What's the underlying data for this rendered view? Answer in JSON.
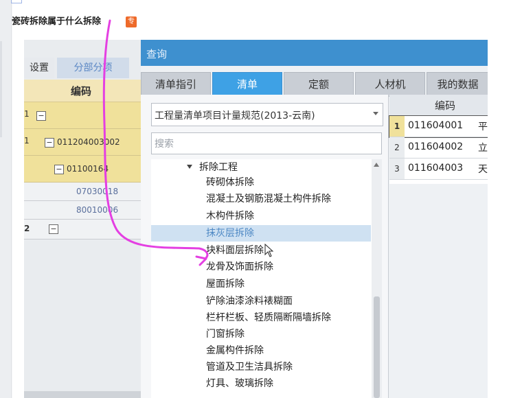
{
  "post": {
    "title": "瓷砖拆除属于什么拆除",
    "tag": "专"
  },
  "background_app": {
    "tabs": [
      "设置",
      "分部分项"
    ],
    "column_header": "编码",
    "rows": [
      {
        "num": "1",
        "code": "",
        "style": "yellow"
      },
      {
        "num": "1",
        "code": "011204003002",
        "style": "yellow"
      },
      {
        "num": "",
        "code": "01100164",
        "style": "yellow"
      },
      {
        "num": "",
        "code": "07030018",
        "style": "white"
      },
      {
        "num": "",
        "code": "80010006",
        "style": "white"
      },
      {
        "num": "2",
        "code": "",
        "style": "white"
      }
    ]
  },
  "dialog": {
    "title": "查询",
    "tabs": [
      "清单指引",
      "清单",
      "定额",
      "人材机",
      "我的数据"
    ],
    "active_tab": "清单",
    "spec_select": "工程量清单项目计量规范(2013-云南)",
    "search_placeholder": "搜索",
    "tree": {
      "root": "拆除工程",
      "items": [
        "砖砌体拆除",
        "混凝土及钢筋混凝土构件拆除",
        "木构件拆除",
        "抹灰层拆除",
        "块料面层拆除",
        "龙骨及饰面拆除",
        "屋面拆除",
        "铲除油漆涂料裱糊面",
        "栏杆栏板、轻质隔断隔墙拆除",
        "门窗拆除",
        "金属构件拆除",
        "管道及卫生洁具拆除",
        "灯具、玻璃拆除"
      ],
      "selected": "抹灰层拆除"
    },
    "result_table": {
      "header": "编码",
      "rows": [
        {
          "no": "1",
          "code": "011604001",
          "name": "平"
        },
        {
          "no": "2",
          "code": "011604002",
          "name": "立"
        },
        {
          "no": "3",
          "code": "011604003",
          "name": "天"
        }
      ]
    }
  },
  "colors": {
    "title_bar": "#3e90cf",
    "active_tab": "#3ea1e5",
    "annotation": "#e43fe2",
    "tag": "#ee6a2a"
  }
}
